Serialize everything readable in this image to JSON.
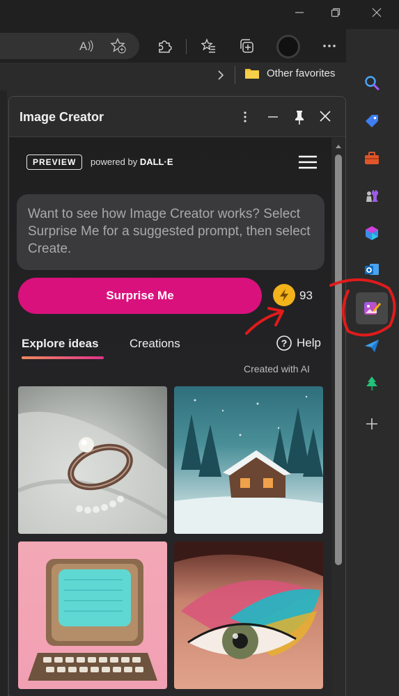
{
  "favbar": {
    "other_favorites": "Other favorites"
  },
  "pane": {
    "title": "Image Creator",
    "preview_label": "PREVIEW",
    "powered_by": "powered by",
    "powered_brand": "DALL·E",
    "prompt_placeholder": "Want to see how Image Creator works? Select Surprise Me for a suggested prompt, then select Create.",
    "surprise_label": "Surprise Me",
    "boost_count": "93",
    "tabs": [
      "Explore ideas",
      "Creations"
    ],
    "help_label": "Help",
    "created_with_ai": "Created with AI",
    "ideas": [
      {
        "icon": "pearl-ring-image"
      },
      {
        "icon": "snowy-cabin-image"
      },
      {
        "icon": "retro-computer-image"
      },
      {
        "icon": "eye-makeup-image"
      }
    ]
  },
  "colors": {
    "surprise_button": "#d9117d",
    "boost_coin": "#f2b31b",
    "tab_underline": "#e8456b",
    "annotation": "#e01b1b"
  }
}
